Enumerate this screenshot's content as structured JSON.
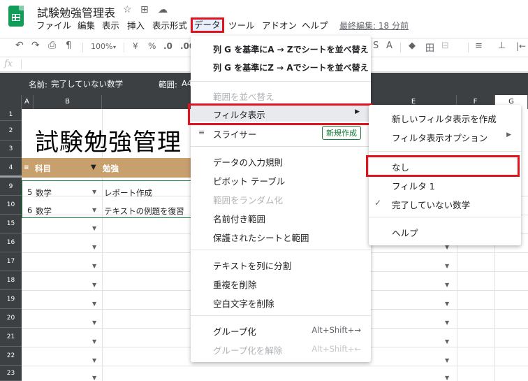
{
  "doc": {
    "title": "試験勉強管理表",
    "star_icon": "☆",
    "folder_icon": "⊞",
    "cloud_icon": "☁",
    "last_edit": "最終編集: 18 分前"
  },
  "menubar": {
    "items": [
      "ファイル",
      "編集",
      "表示",
      "挿入",
      "表示形式",
      "データ",
      "ツール",
      "アドオン",
      "ヘルプ"
    ],
    "active": "データ"
  },
  "toolbar": {
    "undo": "↶",
    "redo": "↷",
    "print": "⎙",
    "paint": "¶",
    "zoom": "100%",
    "currency": "¥",
    "percent": "%",
    "dec_decrease": ".0",
    "dec_increase": ".00",
    "right_items": [
      "S",
      "A",
      "◆",
      "田",
      "⊟",
      "≡",
      "⊥",
      "|←"
    ]
  },
  "formula": {
    "fx": "fx"
  },
  "filter_bar": {
    "name_label": "名前:",
    "name_value": "完了していない数学",
    "range_label": "範囲:",
    "range_value": "A4"
  },
  "grid": {
    "columns": [
      "A",
      "B",
      "E",
      "F",
      "G"
    ],
    "rows": [
      "1",
      "2",
      "3",
      "4",
      "9",
      "10",
      "15",
      "16",
      "17",
      "18",
      "19",
      "20",
      "21",
      "22",
      "23"
    ],
    "big_title": "試験勉強管理",
    "header": {
      "subject": "科目",
      "study": "勉強"
    },
    "data_rows": [
      {
        "num": "5",
        "subject": "数学",
        "task": "レポート作成"
      },
      {
        "num": "6",
        "subject": "数学",
        "task": "テキストの例題を復習"
      }
    ]
  },
  "data_menu": {
    "sort_a_z": "列 G を基準にA → Zでシートを並べ替え",
    "sort_z_a": "列 G を基準にZ → Aでシートを並べ替え",
    "sort_range": "範囲を並べ替え",
    "filter_views": "フィルタ表示",
    "slicer": "スライサー",
    "slicer_badge": "新規作成",
    "data_validation": "データの入力規則",
    "pivot_table": "ピボット テーブル",
    "randomize_range": "範囲をランダム化",
    "named_ranges": "名前付き範囲",
    "protected_sheets": "保護されたシートと範囲",
    "split_text": "テキストを列に分割",
    "remove_duplicates": "重複を削除",
    "trim_whitespace": "空白文字を削除",
    "group": "グループ化",
    "group_shortcut": "Alt+Shift+→",
    "ungroup": "グループ化を解除",
    "ungroup_shortcut": "Alt+Shift+←"
  },
  "sub_menu": {
    "create_new": "新しいフィルタ表示を作成",
    "options": "フィルタ表示オプション",
    "none": "なし",
    "filter1": "フィルタ 1",
    "current": "完了していない数学",
    "help": "ヘルプ"
  }
}
